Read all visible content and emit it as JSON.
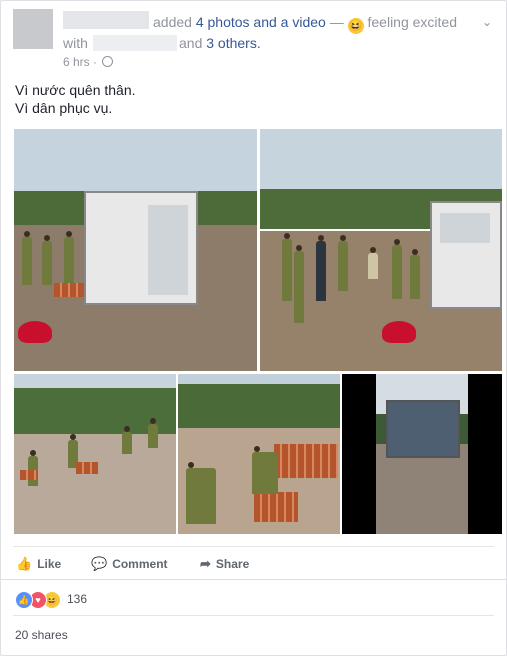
{
  "header": {
    "verb_text": "added",
    "photos_link": "4 photos and a video",
    "dash": "—",
    "emoji": "😆",
    "feeling_text": "feeling excited",
    "with_text": "with",
    "and_text": "and",
    "others_link": "3 others.",
    "time": "6 hrs",
    "chevron": "⌄"
  },
  "post": {
    "line1": "Vì nước quên thân.",
    "line2": "Vì dân phục vụ."
  },
  "actions": {
    "like": "Like",
    "comment": "Comment",
    "share": "Share"
  },
  "reactions": {
    "icons": [
      "like-icon",
      "love-icon",
      "haha-icon"
    ],
    "count": "136"
  },
  "footer": {
    "shares": "20 shares"
  },
  "colors": {
    "link": "#365899",
    "meta": "#90949c",
    "like": "#5890ff",
    "love": "#f25268",
    "haha": "#f7c83b"
  }
}
